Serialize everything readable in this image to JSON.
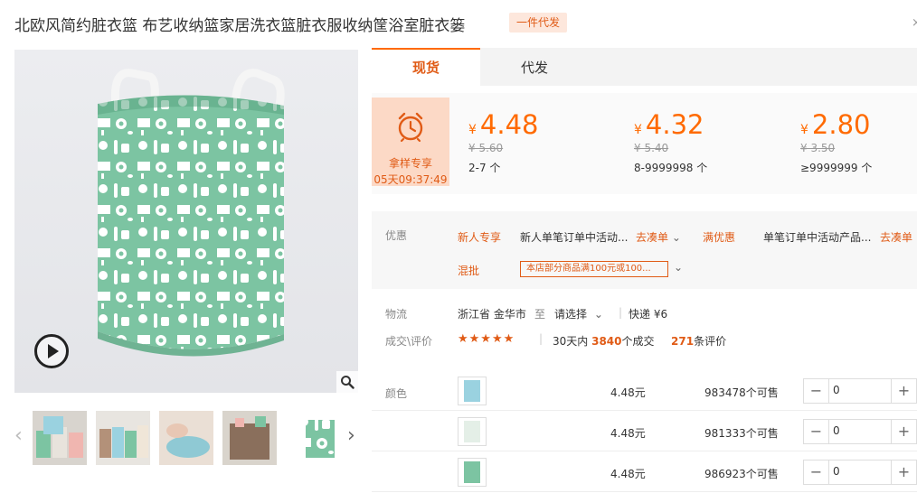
{
  "product": {
    "title": "北欧风简约脏衣篮 布艺收纳篮家居洗衣篮脏衣服收纳筐浴室脏衣篓",
    "dropship_tag": "一件代发",
    "close_glyph": "×"
  },
  "media": {
    "main_image": "laundry-basket-green-kitchen-pattern",
    "play_icon": "play-icon",
    "zoom_icon": "magnifier-icon",
    "thumb_prev": "‹",
    "thumb_next": "›",
    "thumbnails": [
      "basket-multi",
      "basket-lineup",
      "basket-folded",
      "basket-brown",
      "basket-green"
    ]
  },
  "tabs": [
    {
      "label": "现货",
      "active": true
    },
    {
      "label": "代发",
      "active": false
    }
  ],
  "promo": {
    "label": "拿样专享",
    "timer": "05天09:37:49"
  },
  "price_tiers": [
    {
      "currency": "¥",
      "price": "4.48",
      "old_price": "¥ 5.60",
      "quantity": "2-7 个"
    },
    {
      "currency": "¥",
      "price": "4.32",
      "old_price": "¥ 5.40",
      "quantity": "8-9999998 个"
    },
    {
      "currency": "¥",
      "price": "2.80",
      "old_price": "¥ 3.50",
      "quantity": "≥9999999 个"
    }
  ],
  "offers": {
    "label": "优惠",
    "newcomer_tag": "新人专享",
    "newcomer_text": "新人单笔订单中活动...",
    "link1": "去凑单",
    "full_tag": "满优惠",
    "full_text": "单笔订单中活动产品...",
    "link2": "去凑单",
    "mixed_tag": "混批",
    "coupon": "本店部分商品满100元或100..."
  },
  "logistics": {
    "label": "物流",
    "origin": "浙江省 金华市",
    "to": "至",
    "destination": "请选择",
    "shipping": "快递 ¥6"
  },
  "reviews": {
    "label": "成交\\评价",
    "stars": "★★★★★",
    "rating": 5,
    "days_text": "30天内",
    "sold_count": "3840",
    "sold_suffix": "个成交",
    "review_count": "271",
    "review_suffix": "条评价"
  },
  "sku": {
    "label": "颜色",
    "rows": [
      {
        "price": "4.48元",
        "stock": "983478个可售",
        "qty": "0",
        "color": "light-blue"
      },
      {
        "price": "4.48元",
        "stock": "981333个可售",
        "qty": "0",
        "color": "white"
      },
      {
        "price": "4.48元",
        "stock": "986923个可售",
        "qty": "0",
        "color": "green"
      }
    ],
    "minus": "−",
    "plus": "+"
  },
  "colors": {
    "accent": "#ff6a00",
    "accent_text": "#e05b16",
    "basket_green": "#7cc4a2"
  }
}
